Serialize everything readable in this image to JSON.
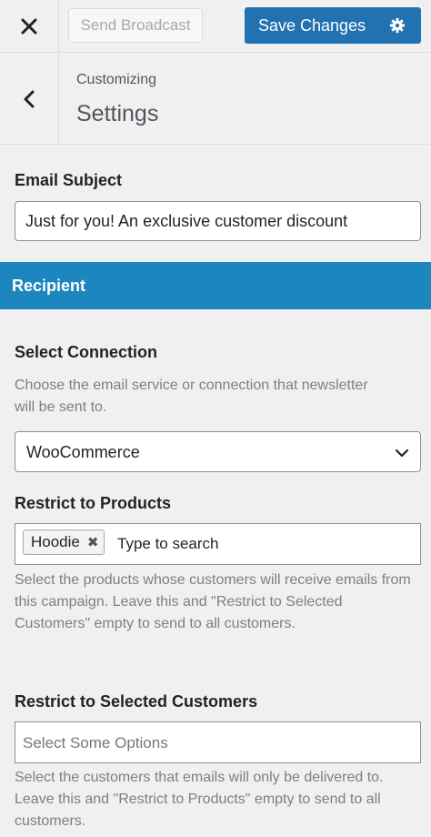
{
  "topbar": {
    "close_icon": "close-icon",
    "send_label": "Send Broadcast",
    "save_label": "Save Changes",
    "gear_icon": "gear-icon"
  },
  "header": {
    "back_icon": "chevron-left-icon",
    "breadcrumb": "Customizing",
    "title": "Settings"
  },
  "email_subject": {
    "label": "Email Subject",
    "value": "Just for you! An exclusive customer discount"
  },
  "recipient": {
    "title": "Recipient"
  },
  "connection": {
    "label": "Select Connection",
    "description": "Choose the email service or connection that newsletter will be sent to.",
    "selected": "WooCommerce"
  },
  "products": {
    "label": "Restrict to Products",
    "tags": [
      "Hoodie"
    ],
    "placeholder": "Type to search",
    "description": "Select the products whose customers will receive emails from this campaign. Leave this and \"Restrict to Selected Customers\" empty to send to all customers."
  },
  "customers": {
    "label": "Restrict to Selected Customers",
    "placeholder": "Select Some Options",
    "description": "Select the customers that emails will only be delivered to. Leave this and \"Restrict to Products\" empty to send to all customers."
  },
  "colors": {
    "primary": "#2271b1",
    "section_bar": "#1e86bf",
    "background": "#f0f0f1"
  }
}
